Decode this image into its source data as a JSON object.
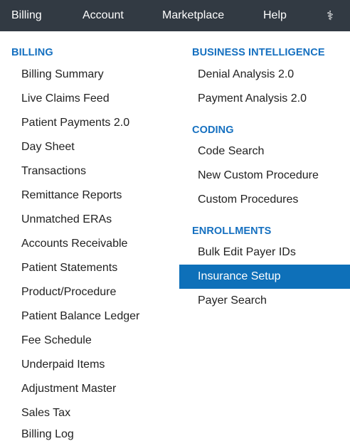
{
  "topnav": {
    "items": [
      {
        "label": "Billing"
      },
      {
        "label": "Account"
      },
      {
        "label": "Marketplace"
      },
      {
        "label": "Help"
      }
    ],
    "caduceus_icon": "⚕"
  },
  "billing": {
    "title": "BILLING",
    "items": [
      "Billing Summary",
      "Live Claims Feed",
      "Patient Payments 2.0",
      "Day Sheet",
      "Transactions",
      "Remittance Reports",
      "Unmatched ERAs",
      "Accounts Receivable",
      "Patient Statements",
      "Product/Procedure",
      "Patient Balance Ledger",
      "Fee Schedule",
      "Underpaid Items",
      "Adjustment Master",
      "Sales Tax",
      "Billing Log"
    ]
  },
  "business_intelligence": {
    "title": "BUSINESS INTELLIGENCE",
    "items": [
      "Denial Analysis 2.0",
      "Payment Analysis 2.0"
    ]
  },
  "coding": {
    "title": "CODING",
    "items": [
      "Code Search",
      "New Custom Procedure",
      "Custom Procedures"
    ]
  },
  "enrollments": {
    "title": "ENROLLMENTS",
    "items": [
      "Bulk Edit Payer IDs",
      "Insurance Setup",
      "Payer Search"
    ],
    "selected": "Insurance Setup"
  },
  "colors": {
    "nav_bg": "#323a43",
    "section_title": "#1570c0",
    "selected_bg": "#0e70b9"
  }
}
